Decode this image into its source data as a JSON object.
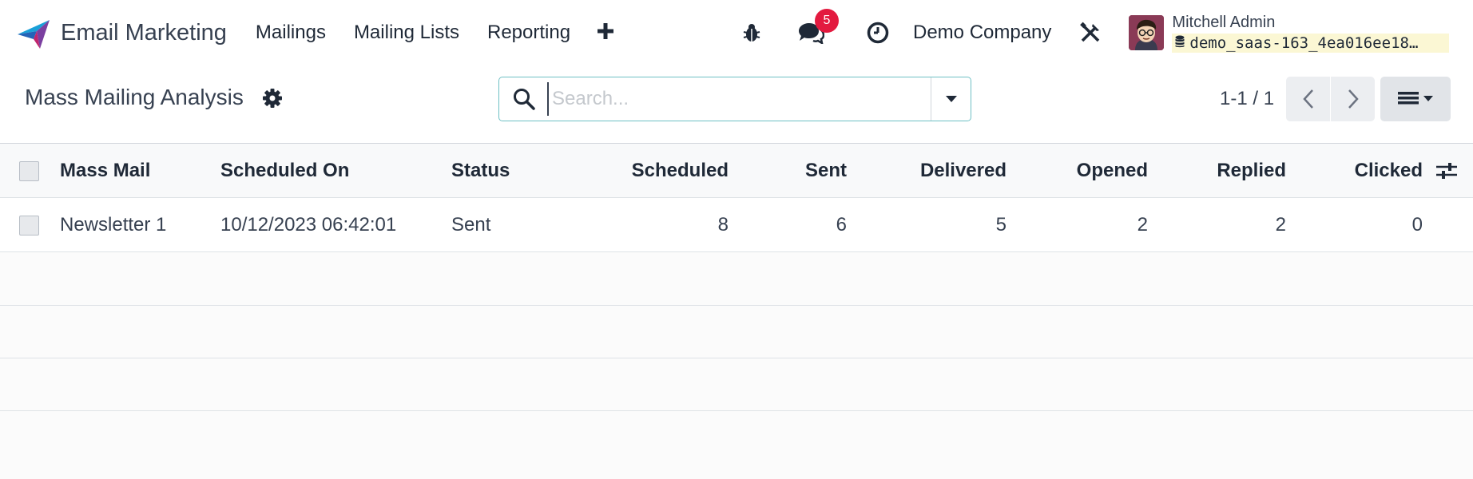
{
  "app": {
    "name": "Email Marketing"
  },
  "nav": {
    "items": [
      {
        "label": "Mailings"
      },
      {
        "label": "Mailing Lists"
      },
      {
        "label": "Reporting"
      }
    ],
    "plus_icon": "plus-icon"
  },
  "systray": {
    "debug_icon": "bug-icon",
    "messages_icon": "chat-icon",
    "messages_count": "5",
    "activity_icon": "clock-icon",
    "company": "Demo Company",
    "tools_icon": "tools-icon",
    "user_name": "Mitchell Admin",
    "database": "demo_saas-163_4ea016ee18…"
  },
  "control": {
    "title": "Mass Mailing Analysis",
    "search_placeholder": "Search...",
    "search_value": "",
    "pager": "1-1 / 1"
  },
  "table": {
    "columns": [
      "Mass Mail",
      "Scheduled On",
      "Status",
      "Scheduled",
      "Sent",
      "Delivered",
      "Opened",
      "Replied",
      "Clicked"
    ],
    "rows": [
      {
        "mass_mail": "Newsletter 1",
        "scheduled_on": "10/12/2023 06:42:01",
        "status": "Sent",
        "scheduled": "8",
        "sent": "6",
        "delivered": "5",
        "opened": "2",
        "replied": "2",
        "clicked": "0"
      }
    ]
  },
  "colors": {
    "accent": "#6ec0c4",
    "badge": "#e31a3f",
    "db_badge_bg": "#fbf7d4"
  }
}
